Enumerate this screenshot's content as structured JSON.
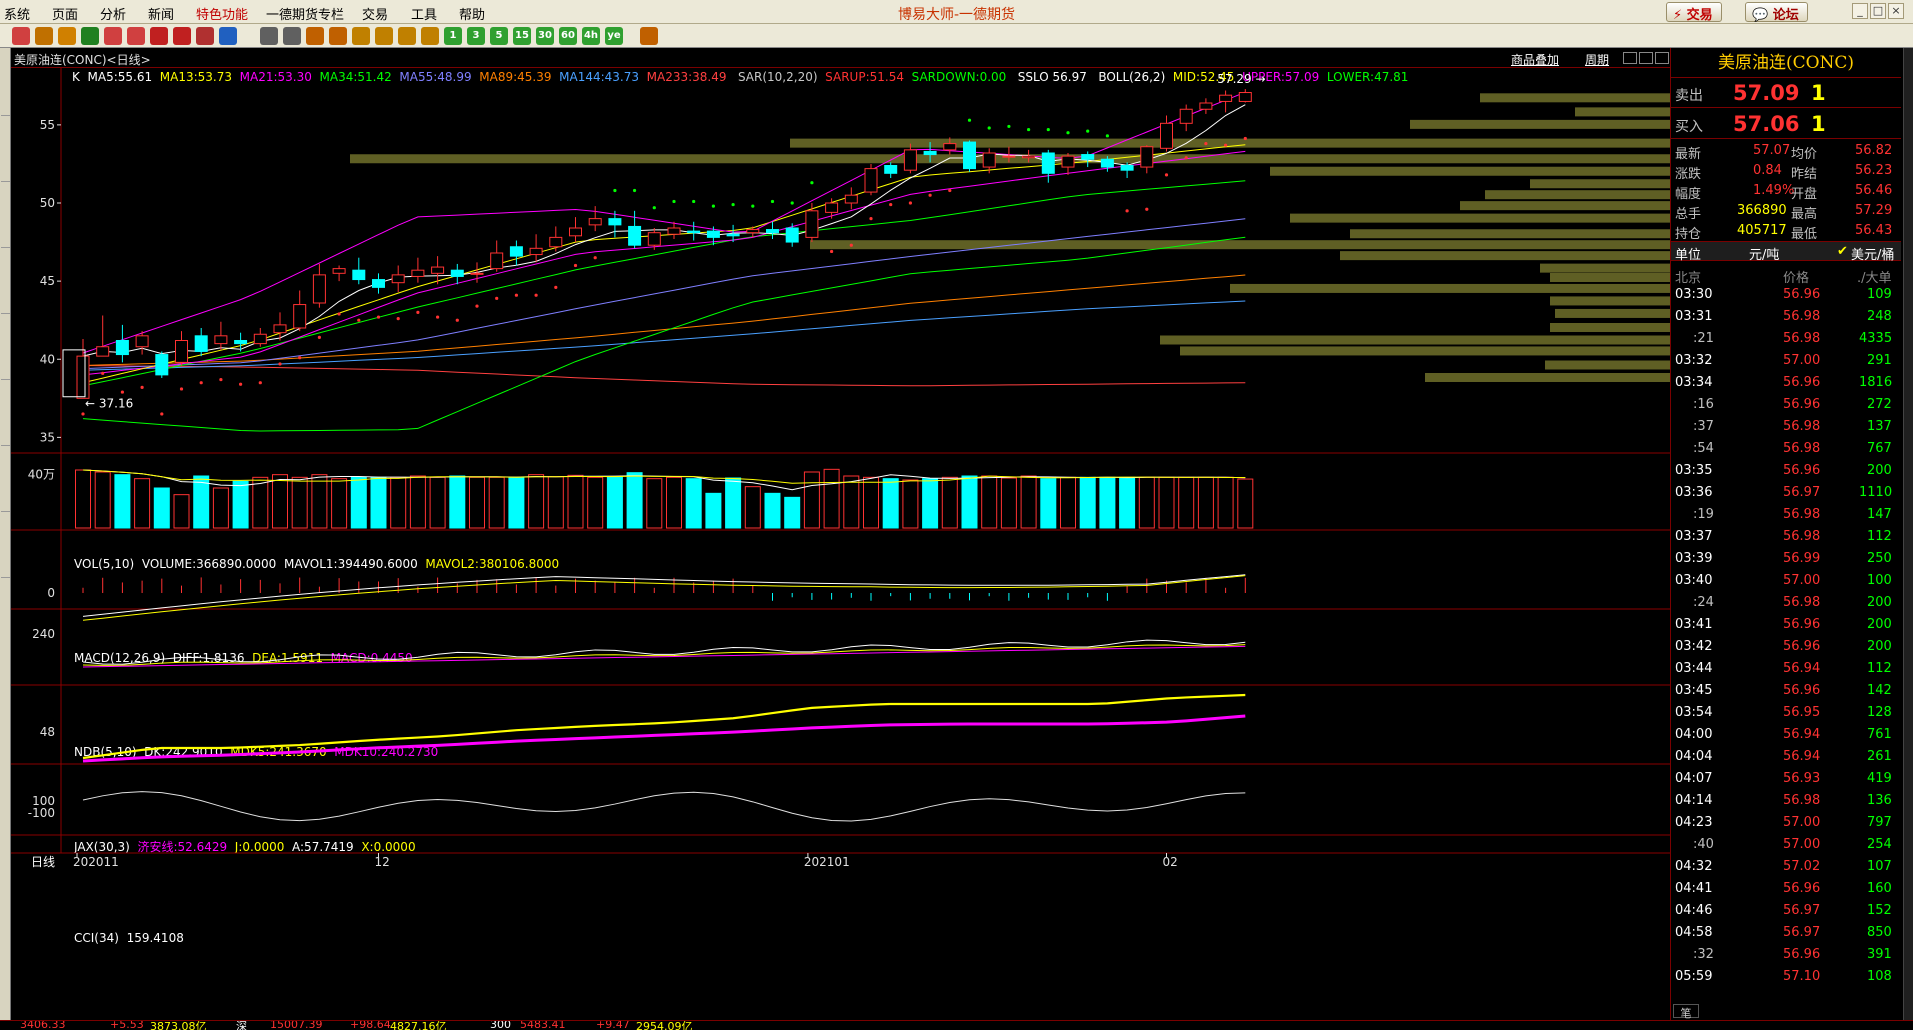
{
  "app": {
    "title": "博易大师-一德期货"
  },
  "menu": [
    "系统",
    "页面",
    "分析",
    "新闻",
    "特色功能",
    "一德期货专栏",
    "交易",
    "工具",
    "帮助"
  ],
  "top_buttons": {
    "trade": "交易",
    "forum": "论坛"
  },
  "toolbar_icons": [
    "home-icon",
    "back-icon",
    "folder-icon",
    "refresh-icon",
    "zoom-in-icon",
    "zoom-out-icon",
    "pen-icon",
    "draw-icon",
    "funnel-icon",
    "news-icon",
    "grid-icon",
    "list-icon",
    "ticker-icon",
    "intraday-icon",
    "daily-icon",
    "weekly-icon",
    "monthly-icon",
    "minute-icon",
    "1",
    "3",
    "5",
    "15",
    "30",
    "60",
    "4h",
    "year",
    "calculator-icon"
  ],
  "chart": {
    "title": "美原油连(CONC)<日线>",
    "add_product": "商品叠加",
    "period": "周期",
    "main_ind": {
      "prefix": "K",
      "ma5": "MA5:55.61",
      "ma13": "MA13:53.73",
      "ma21": "MA21:53.30",
      "ma34": "MA34:51.42",
      "ma55": "MA55:48.99",
      "ma89": "MA89:45.39",
      "ma144": "MA144:43.73",
      "ma233": "MA233:38.49",
      "sar": "SAR(10,2,20)",
      "sarup": "SARUP:51.54",
      "sardown": "SARDOWN:0.00",
      "sslo": "SSLO  56.97",
      "boll": "BOLL(26,2)",
      "mid": "MID:52.45",
      "upper": "UPPER:57.09",
      "lower": "LOWER:47.81"
    },
    "price_ticks": [
      "55",
      "50",
      "45",
      "40",
      "35"
    ],
    "high_label": "57.29",
    "low_label": "37.16",
    "vol_ind": {
      "prefix": "VOL(5,10)",
      "volume": "VOLUME:366890.0000",
      "mavol1": "MAVOL1:394490.6000",
      "mavol2": "MAVOL2:380106.8000"
    },
    "vol_tick": "40万",
    "macd_ind": {
      "prefix": "MACD(12,26,9)",
      "diff": "DIFF:1.8136",
      "dea": "DEA:1.5911",
      "macd": "MACD:0.4450"
    },
    "macd_tick": "0",
    "ndb_ind": {
      "prefix": "NDB(5,10)",
      "dk": "DK:242.9010",
      "mdk5": "MDK5:241.3670",
      "mdk10": "MDK10:240.2730"
    },
    "ndb_tick": "240",
    "jax_ind": {
      "prefix": "JAX(30,3)",
      "jj": "济安线:52.6429",
      "j": "J:0.0000",
      "a": "A:57.7419",
      "x": "X:0.0000"
    },
    "jax_tick": "48",
    "cci_ind": {
      "prefix": "CCI(34)",
      "value": "159.4108"
    },
    "cci_ticks": [
      "100",
      "-100"
    ],
    "period_label": "日线",
    "date_labels": [
      "202011",
      "12",
      "202101",
      "02"
    ]
  },
  "quote": {
    "title": "美原油连(CONC)",
    "sell": {
      "label": "卖出",
      "price": "57.09",
      "volume": "1"
    },
    "buy": {
      "label": "买入",
      "price": "57.06",
      "volume": "1"
    },
    "stats": [
      {
        "label": "最新",
        "value": "57.07",
        "label2": "均价",
        "value2": "56.82"
      },
      {
        "label": "涨跌",
        "value": "0.84",
        "label2": "昨结",
        "value2": "56.23"
      },
      {
        "label": "幅度",
        "value": "1.49%",
        "label2": "开盘",
        "value2": "56.46"
      },
      {
        "label": "总手",
        "value": "366890",
        "label2": "最高",
        "value2": "57.29"
      },
      {
        "label": "持仓",
        "value": "405717",
        "label2": "最低",
        "value2": "56.43"
      }
    ],
    "unit_label": "单位",
    "unit_value": "元/吨",
    "currency": "美元/桶",
    "ticks_header": {
      "time": "北京",
      "price": "价格",
      "vol": "./大单"
    },
    "ticks": [
      {
        "time": "03:30",
        "price": "56.96",
        "vol": "109"
      },
      {
        "time": "03:31",
        "price": "56.98",
        "vol": "248"
      },
      {
        "time": ":21",
        "price": "56.98",
        "vol": "4335"
      },
      {
        "time": "03:32",
        "price": "57.00",
        "vol": "291"
      },
      {
        "time": "03:34",
        "price": "56.96",
        "vol": "1816"
      },
      {
        "time": ":16",
        "price": "56.96",
        "vol": "272"
      },
      {
        "time": ":37",
        "price": "56.98",
        "vol": "137"
      },
      {
        "time": ":54",
        "price": "56.98",
        "vol": "767"
      },
      {
        "time": "03:35",
        "price": "56.96",
        "vol": "200"
      },
      {
        "time": "03:36",
        "price": "56.97",
        "vol": "1110"
      },
      {
        "time": ":19",
        "price": "56.98",
        "vol": "147"
      },
      {
        "time": "03:37",
        "price": "56.98",
        "vol": "112"
      },
      {
        "time": "03:39",
        "price": "56.99",
        "vol": "250"
      },
      {
        "time": "03:40",
        "price": "57.00",
        "vol": "100"
      },
      {
        "time": ":24",
        "price": "56.98",
        "vol": "200"
      },
      {
        "time": "03:41",
        "price": "56.96",
        "vol": "200"
      },
      {
        "time": "03:42",
        "price": "56.96",
        "vol": "200"
      },
      {
        "time": "03:44",
        "price": "56.94",
        "vol": "112"
      },
      {
        "time": "03:45",
        "price": "56.96",
        "vol": "142"
      },
      {
        "time": "03:54",
        "price": "56.95",
        "vol": "128"
      },
      {
        "time": "04:00",
        "price": "56.94",
        "vol": "761"
      },
      {
        "time": "04:04",
        "price": "56.94",
        "vol": "261"
      },
      {
        "time": "04:07",
        "price": "56.93",
        "vol": "419"
      },
      {
        "time": "04:14",
        "price": "56.98",
        "vol": "136"
      },
      {
        "time": "04:23",
        "price": "57.00",
        "vol": "797"
      },
      {
        "time": ":40",
        "price": "57.00",
        "vol": "254"
      },
      {
        "time": "04:32",
        "price": "57.02",
        "vol": "107"
      },
      {
        "time": "04:41",
        "price": "56.96",
        "vol": "160"
      },
      {
        "time": "04:46",
        "price": "56.97",
        "vol": "152"
      },
      {
        "time": "04:58",
        "price": "56.97",
        "vol": "850"
      },
      {
        "time": ":32",
        "price": "56.96",
        "vol": "391"
      },
      {
        "time": "05:59",
        "price": "57.10",
        "vol": "108"
      }
    ],
    "pen_label": "笔"
  },
  "statusbar": [
    "3406.33",
    "+5.53",
    "3873.08亿",
    "深",
    "15007.39",
    "+98.64",
    "4827.16亿",
    "300",
    "5483.41",
    "+9.47",
    "2954.09亿"
  ],
  "colors": {
    "up": "#ff3232",
    "down": "#00ffff",
    "ma5": "#ffffff",
    "ma13": "#ffff00",
    "ma21": "#ff00ff",
    "ma34": "#00ff00",
    "ma55": "#7f7fff",
    "ma89": "#ff8000",
    "ma144": "#4aa0ff",
    "ma233": "#ff4040",
    "vp": "#70702a"
  },
  "chart_data": {
    "type": "candlestick",
    "candles": [
      [
        37.5,
        40.2,
        38,
        41.3
      ],
      [
        40.2,
        40.8,
        40.8,
        42.8
      ],
      [
        41.2,
        40.3,
        39.8,
        42.2
      ],
      [
        40.8,
        41.5,
        40.3,
        41.8
      ],
      [
        40.3,
        39,
        38.8,
        40.5
      ],
      [
        39.8,
        41.2,
        39.6,
        41.8
      ],
      [
        41.5,
        40.5,
        40.2,
        42
      ],
      [
        41,
        41.5,
        40.6,
        42.4
      ],
      [
        41.2,
        41,
        40.5,
        41.7
      ],
      [
        41,
        41.6,
        40.8,
        42
      ],
      [
        41.7,
        42.2,
        41.2,
        43
      ],
      [
        42,
        43.5,
        41.8,
        44.4
      ],
      [
        43.6,
        45.4,
        43.3,
        46.1
      ],
      [
        45.5,
        45.8,
        45,
        46
      ],
      [
        45.7,
        45.1,
        44.8,
        46.5
      ],
      [
        45.1,
        44.6,
        44.2,
        45.5
      ],
      [
        44.9,
        45.4,
        44.3,
        46
      ],
      [
        45.3,
        45.7,
        44.9,
        46.5
      ],
      [
        45.5,
        45.9,
        44.8,
        46.6
      ],
      [
        45.7,
        45.3,
        44.8,
        46.1
      ],
      [
        45.5,
        45.5,
        44.9,
        46.2
      ],
      [
        45.8,
        46.8,
        45.6,
        47.6
      ],
      [
        47.2,
        46.6,
        46,
        47.6
      ],
      [
        46.7,
        47.1,
        46.2,
        48
      ],
      [
        47.2,
        47.8,
        46.9,
        48.5
      ],
      [
        47.9,
        48.4,
        47.5,
        49.1
      ],
      [
        48.6,
        49,
        48.2,
        49.8
      ],
      [
        49,
        48.6,
        47.8,
        49.5
      ],
      [
        48.5,
        47.3,
        47.1,
        49.5
      ],
      [
        47.3,
        48.1,
        47,
        48.4
      ],
      [
        48,
        48.4,
        47.7,
        48.8
      ],
      [
        48.2,
        48.1,
        47.6,
        48.8
      ],
      [
        48.2,
        47.8,
        47.3,
        48.5
      ],
      [
        48,
        47.9,
        47.5,
        48.6
      ],
      [
        48.1,
        48.3,
        47.8,
        48.5
      ],
      [
        48.3,
        48.1,
        47.7,
        48.8
      ],
      [
        48.4,
        47.5,
        47.2,
        48.7
      ],
      [
        47.8,
        49.5,
        47.5,
        50
      ],
      [
        49.4,
        50,
        49,
        50.3
      ],
      [
        50,
        50.5,
        49.6,
        51
      ],
      [
        50.7,
        52.2,
        50.5,
        52.5
      ],
      [
        52.4,
        51.9,
        51.6,
        52.6
      ],
      [
        52.1,
        53.4,
        51.9,
        53.8
      ],
      [
        53.3,
        53.1,
        52.6,
        53.9
      ],
      [
        53.4,
        53.8,
        53.1,
        54.2
      ],
      [
        53.9,
        52.2,
        52,
        54
      ],
      [
        52.3,
        53.2,
        51.9,
        53.5
      ],
      [
        53,
        53,
        52.6,
        53.6
      ],
      [
        52.9,
        53,
        52.6,
        53.4
      ],
      [
        53.2,
        51.9,
        51.3,
        53.4
      ],
      [
        52.3,
        53,
        51.8,
        53.2
      ],
      [
        53.1,
        52.8,
        52.3,
        53.3
      ],
      [
        52.8,
        52.3,
        52,
        53
      ],
      [
        52.4,
        52.1,
        51.6,
        52.6
      ],
      [
        52.3,
        53.6,
        51.9,
        53.7
      ],
      [
        53.5,
        55.1,
        53.3,
        55.6
      ],
      [
        55.1,
        56,
        54.6,
        56.3
      ],
      [
        56,
        56.4,
        55.7,
        56.7
      ],
      [
        56.5,
        56.9,
        55.8,
        57.2
      ],
      [
        56.5,
        57.07,
        56.43,
        57.29
      ]
    ],
    "volumes": [
      435,
      420,
      400,
      370,
      300,
      250,
      390,
      300,
      350,
      380,
      400,
      380,
      400,
      370,
      380,
      380,
      380,
      390,
      380,
      390,
      380,
      380,
      380,
      400,
      385,
      395,
      380,
      385,
      415,
      370,
      380,
      370,
      260,
      375,
      310,
      260,
      230,
      420,
      440,
      390,
      380,
      370,
      360,
      370,
      380,
      390,
      390,
      375,
      390,
      370,
      380,
      380,
      380,
      380,
      380,
      380,
      380,
      380,
      380,
      367
    ],
    "volume_ref": "40万",
    "price_range": [
      34,
      58
    ]
  }
}
